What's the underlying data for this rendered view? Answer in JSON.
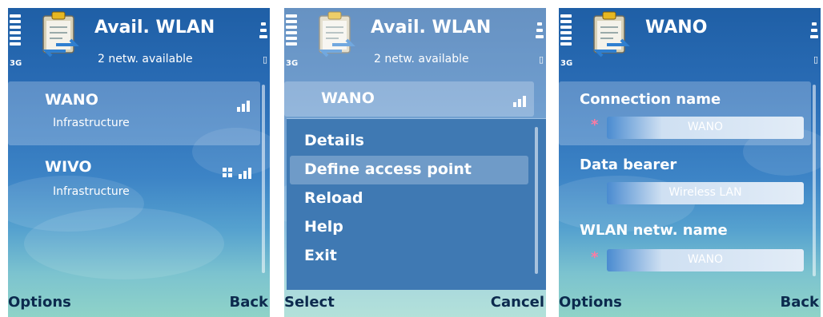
{
  "screen1": {
    "title": "Avail. WLAN",
    "subtitle": "2 netw. available",
    "network_type": "3G",
    "networks": [
      {
        "name": "WANO",
        "type": "Infrastructure"
      },
      {
        "name": "WIVO",
        "type": "Infrastructure"
      }
    ],
    "softkeys": {
      "left": "Options",
      "right": "Back"
    }
  },
  "screen2": {
    "title": "Avail. WLAN",
    "subtitle": "2 netw. available",
    "network_type": "3G",
    "selected_network": "WANO",
    "menu_items": [
      "Details",
      "Define access point",
      "Reload",
      "Help",
      "Exit"
    ],
    "highlighted_index": 1,
    "softkeys": {
      "left": "Select",
      "right": "Cancel"
    }
  },
  "screen3": {
    "title": "WANO",
    "network_type": "3G",
    "fields": [
      {
        "label": "Connection name",
        "value": "WANO",
        "required": true
      },
      {
        "label": "Data bearer",
        "value": "Wireless LAN",
        "required": false
      },
      {
        "label": "WLAN netw. name",
        "value": "WANO",
        "required": true
      }
    ],
    "required_marker": "*",
    "softkeys": {
      "left": "Options",
      "right": "Back"
    }
  },
  "colors": {
    "background_top": "#1f5fa6",
    "background_bottom": "#8fd3c8",
    "softkey_text": "#0c2a4e",
    "required_marker": "#ff7aa2"
  }
}
